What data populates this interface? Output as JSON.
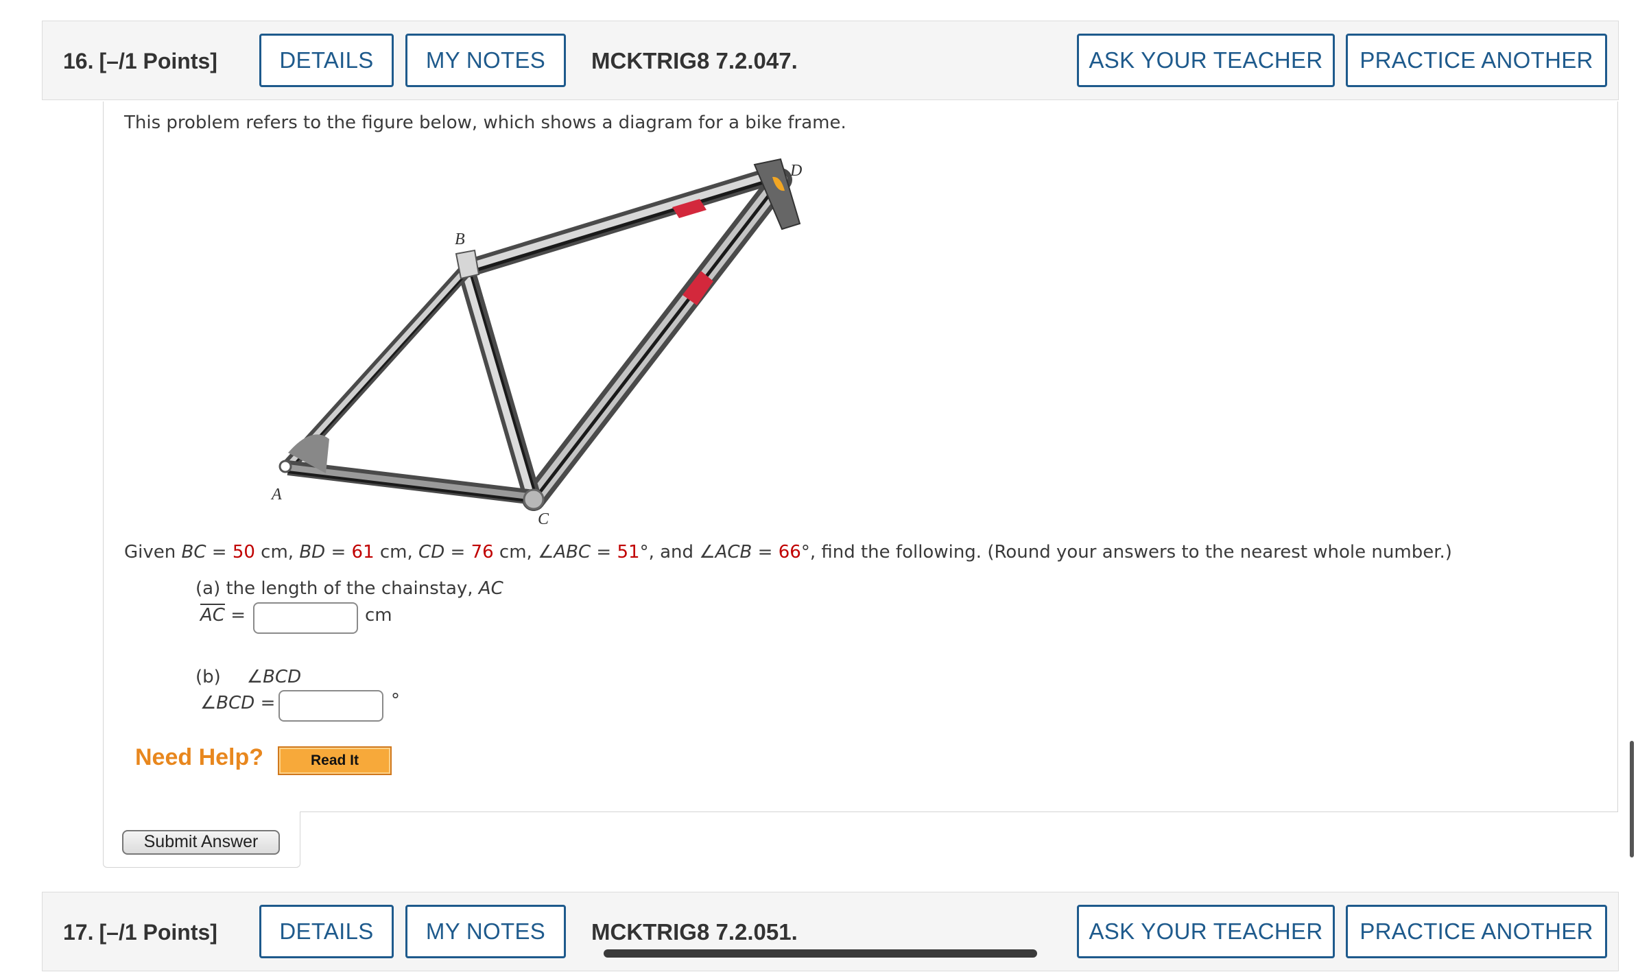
{
  "question16": {
    "number": "16.",
    "points": "[–/1 Points]",
    "details_label": "DETAILS",
    "notes_label": "MY NOTES",
    "code": "MCKTRIG8 7.2.047.",
    "ask_label": "ASK YOUR TEACHER",
    "practice_label": "PRACTICE ANOTHER",
    "intro": "This problem refers to the figure below, which shows a diagram for a bike frame.",
    "figure_labels": {
      "a": "A",
      "b": "B",
      "c": "C",
      "d": "D"
    },
    "given": {
      "prefix": "Given ",
      "bc_label": "BC",
      "bc_value": "50",
      "bd_label": "BD",
      "bd_value": "61",
      "cd_label": "CD",
      "cd_value": "76",
      "abc_label": "∠ABC",
      "abc_value": "51",
      "acb_label": "∠ACB",
      "acb_value": "66",
      "eq": " = ",
      "cm": " cm, ",
      "deg": "°",
      "and": ", and ",
      "suffix": ", find the following. (Round your answers to the nearest whole number.)"
    },
    "part_a": {
      "prompt": "(a) the length of the chainstay, ",
      "prompt_var": "AC",
      "answer_label": "AC",
      "eq": " =",
      "unit": "cm",
      "value": ""
    },
    "part_b": {
      "prompt": "(b)",
      "prompt_var": "∠BCD",
      "answer_label": "∠BCD",
      "eq": " =",
      "unit": "°",
      "value": ""
    },
    "need_help": "Need Help?",
    "read_it": "Read It",
    "submit": "Submit Answer"
  },
  "question17": {
    "number": "17.",
    "points": "[–/1 Points]",
    "details_label": "DETAILS",
    "notes_label": "MY NOTES",
    "code": "MCKTRIG8 7.2.051.",
    "ask_label": "ASK YOUR TEACHER",
    "practice_label": "PRACTICE ANOTHER"
  },
  "colors": {
    "accent": "#1e5a8c",
    "given_value": "#c00000",
    "need_help": "#e8871e",
    "read_it_bg": "#f7a93a"
  }
}
